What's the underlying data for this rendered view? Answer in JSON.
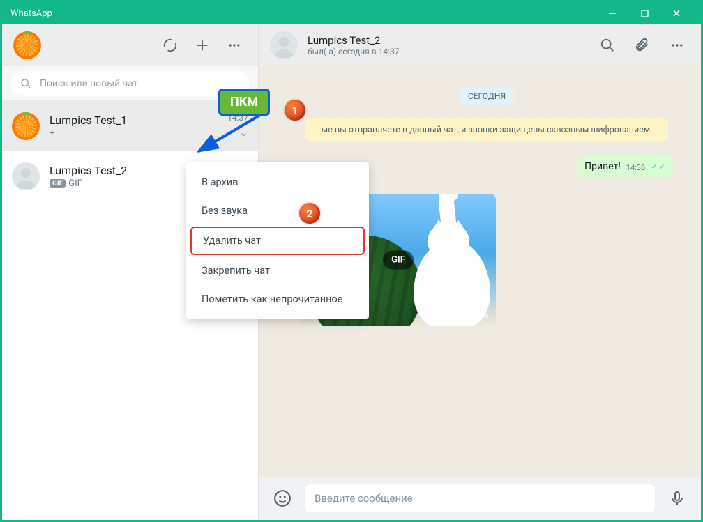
{
  "window": {
    "title": "WhatsApp"
  },
  "sidebar": {
    "search_placeholder": "Поиск или новый чат",
    "chats": [
      {
        "name": "Lumpics Test_1",
        "preview": "+",
        "time": "14:37"
      },
      {
        "name": "Lumpics Test_2",
        "preview": "GIF",
        "gif_badge": "GIF"
      }
    ]
  },
  "context_menu": {
    "items": [
      "В архив",
      "Без звука",
      "Удалить чат",
      "Закрепить чат",
      "Пометить как непрочитанное"
    ]
  },
  "chat": {
    "name": "Lumpics Test_2",
    "status": "был(-а) сегодня в 14:37",
    "date_label": "СЕГОДНЯ",
    "encryption_notice": "ые вы отправляете в данный чат, и звонки защищены сквозным шифрованием.",
    "messages": [
      {
        "type": "out_text",
        "text": "Привет!",
        "time": "14:36"
      },
      {
        "type": "gif",
        "label": "GIF",
        "source": "tenor",
        "time": "14:36"
      }
    ],
    "composer_placeholder": "Введите сообщение"
  },
  "annotations": {
    "rmb_label": "ПКМ",
    "badge1": "1",
    "badge2": "2"
  }
}
